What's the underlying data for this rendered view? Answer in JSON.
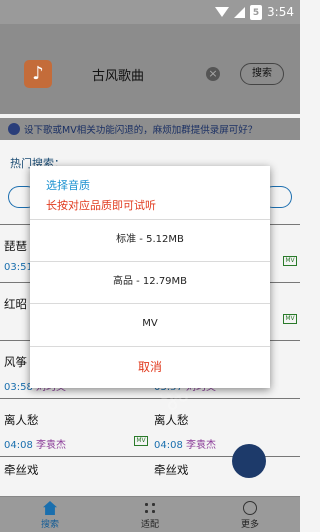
{
  "status": {
    "time": "3:54"
  },
  "header": {
    "search_text": "古风歌曲",
    "search_button": "搜索"
  },
  "notice": {
    "text": "设下歌或MV相关功能闪退的，麻烦加群提供录屏可好？"
  },
  "hot": {
    "title": "热门搜索："
  },
  "songs": [
    {
      "left": {
        "title": "琵琶",
        "time": "03:51"
      },
      "right": {
        "title": "",
        "time": ""
      }
    },
    {
      "left": {
        "title": "红昭",
        "time": ""
      },
      "right": {
        "title": "",
        "time": ""
      }
    },
    {
      "left": {
        "title": "风筝",
        "time": "03:58",
        "artist": "刘珂矣"
      },
      "right": {
        "title": "",
        "time": "03:57",
        "artist": "刘珂矣"
      }
    },
    {
      "left": {
        "title": "离人愁",
        "time": "04:08",
        "artist": "李袁杰"
      },
      "right": {
        "title": "离人愁",
        "time": "04:08",
        "artist": "李袁杰"
      }
    },
    {
      "left": {
        "title": "牵丝戏"
      },
      "right": {
        "title": "牵丝戏"
      }
    }
  ],
  "nav": {
    "items": [
      {
        "label": "搜索"
      },
      {
        "label": "适配"
      },
      {
        "label": "更多"
      }
    ]
  },
  "dialog": {
    "title": "选择音质",
    "subtitle": "长按对应品质即可试听",
    "options": [
      {
        "label": "标准 - 5.12MB"
      },
      {
        "label": "高品 - 12.79MB"
      },
      {
        "label": "MV"
      }
    ],
    "cancel": "取消"
  },
  "colors": {
    "accent": "#1a91d0",
    "warning": "#e13a1e",
    "time": "#1a6fae",
    "artist": "#8a3a98"
  }
}
